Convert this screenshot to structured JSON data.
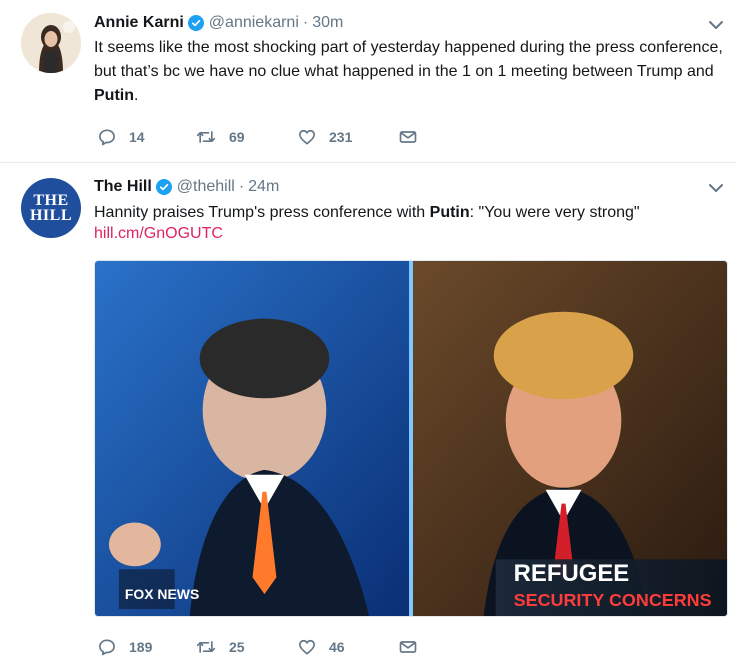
{
  "colors": {
    "text": "#14171a",
    "muted": "#657786",
    "verified": "#1da1f2",
    "link": "#e0245e",
    "divider": "#e6ecf0",
    "hill_brand": "#1f4f9c"
  },
  "tweets": [
    {
      "author": {
        "name": "Annie Karni",
        "handle": "@anniekarni",
        "verified": true
      },
      "time": "30m",
      "text_parts": [
        "It seems like the most shocking part of yesterday happened during the press conference, but that’s bc we have no clue what happened in the 1 on 1 meeting between Trump and ",
        "Putin",
        "."
      ],
      "actions": {
        "replies": "14",
        "retweets": "69",
        "likes": "231"
      },
      "icons": {
        "reply": "reply-icon",
        "retweet": "retweet-icon",
        "like": "heart-icon",
        "dm": "envelope-icon",
        "menu": "chevron-down-icon"
      }
    },
    {
      "author": {
        "name": "The Hill",
        "handle": "@thehill",
        "verified": true,
        "avatar_text": [
          "THE",
          "HILL"
        ]
      },
      "time": "24m",
      "text_parts": [
        "Hannity praises Trump's press conference with ",
        "Putin",
        ": \"You were very strong\""
      ],
      "link": "hill.cm/GnOGUTC",
      "media": {
        "banner_line1": "REFUGEE",
        "banner_line2": "SECURITY CONCERNS",
        "network_logo": "FOX NEWS"
      },
      "actions": {
        "replies": "189",
        "retweets": "25",
        "likes": "46"
      },
      "icons": {
        "reply": "reply-icon",
        "retweet": "retweet-icon",
        "like": "heart-icon",
        "dm": "envelope-icon",
        "menu": "chevron-down-icon"
      }
    }
  ]
}
